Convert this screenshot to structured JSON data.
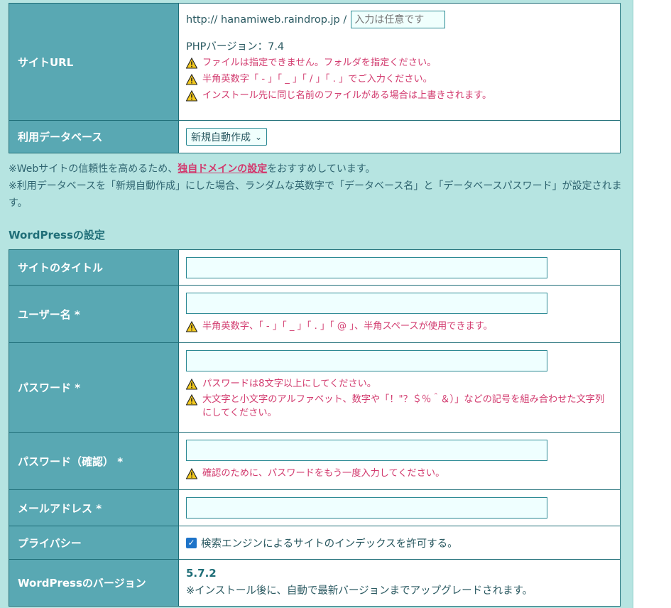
{
  "site": {
    "url_label": "サイトURL",
    "url_prefix": "http:// hanamiweb.raindrop.jp /",
    "url_placeholder": "入力は任意です",
    "php_version": "PHPバージョン：7.4",
    "warnings": [
      "ファイルは指定できません。フォルダを指定ください。",
      "半角英数字「 - 」「 _ 」「 / 」「 . 」でご入力ください。",
      "インストール先に同じ名前のファイルがある場合は上書きされます。"
    ],
    "db_label": "利用データベース",
    "db_value": "新規自動作成"
  },
  "notes": {
    "line1_before": "※Webサイトの信頼性を高めるため、",
    "line1_link": "独自ドメインの設定",
    "line1_after": "をおすすめしています。",
    "line2": "※利用データベースを「新規自動作成」にした場合、ランダムな英数字で「データベース名」と「データベースパスワード」が設定されます。"
  },
  "wordpress": {
    "heading": "WordPressの設定",
    "title_label": "サイトのタイトル",
    "username_label": "ユーザー名 *",
    "username_warning": "半角英数字、「 - 」「 _ 」「 . 」「 @ 」、半角スペースが使用できます。",
    "password_label": "パスワード *",
    "password_warnings": [
      "パスワードは8文字以上にしてください。",
      "大文字と小文字のアルファベット、数字や「！\"？＄％＾＆）」などの記号を組み合わせた文字列にしてください。"
    ],
    "password_confirm_label": "パスワード（確認） *",
    "password_confirm_warning": "確認のために、パスワードをもう一度入力してください。",
    "email_label": "メールアドレス *",
    "privacy_label": "プライバシー",
    "privacy_checkbox_text": "検索エンジンによるサイトのインデックスを許可する。",
    "version_label": "WordPressのバージョン",
    "version_value": "5.7.2",
    "version_note": "※インストール後に、自動で最新バージョンまでアップグレードされます。"
  },
  "colors": {
    "panel_bg": "#b6e4e1",
    "header_cell_bg": "#59a8b3",
    "warning_text": "#d23a6e",
    "border": "#1f6e78"
  }
}
